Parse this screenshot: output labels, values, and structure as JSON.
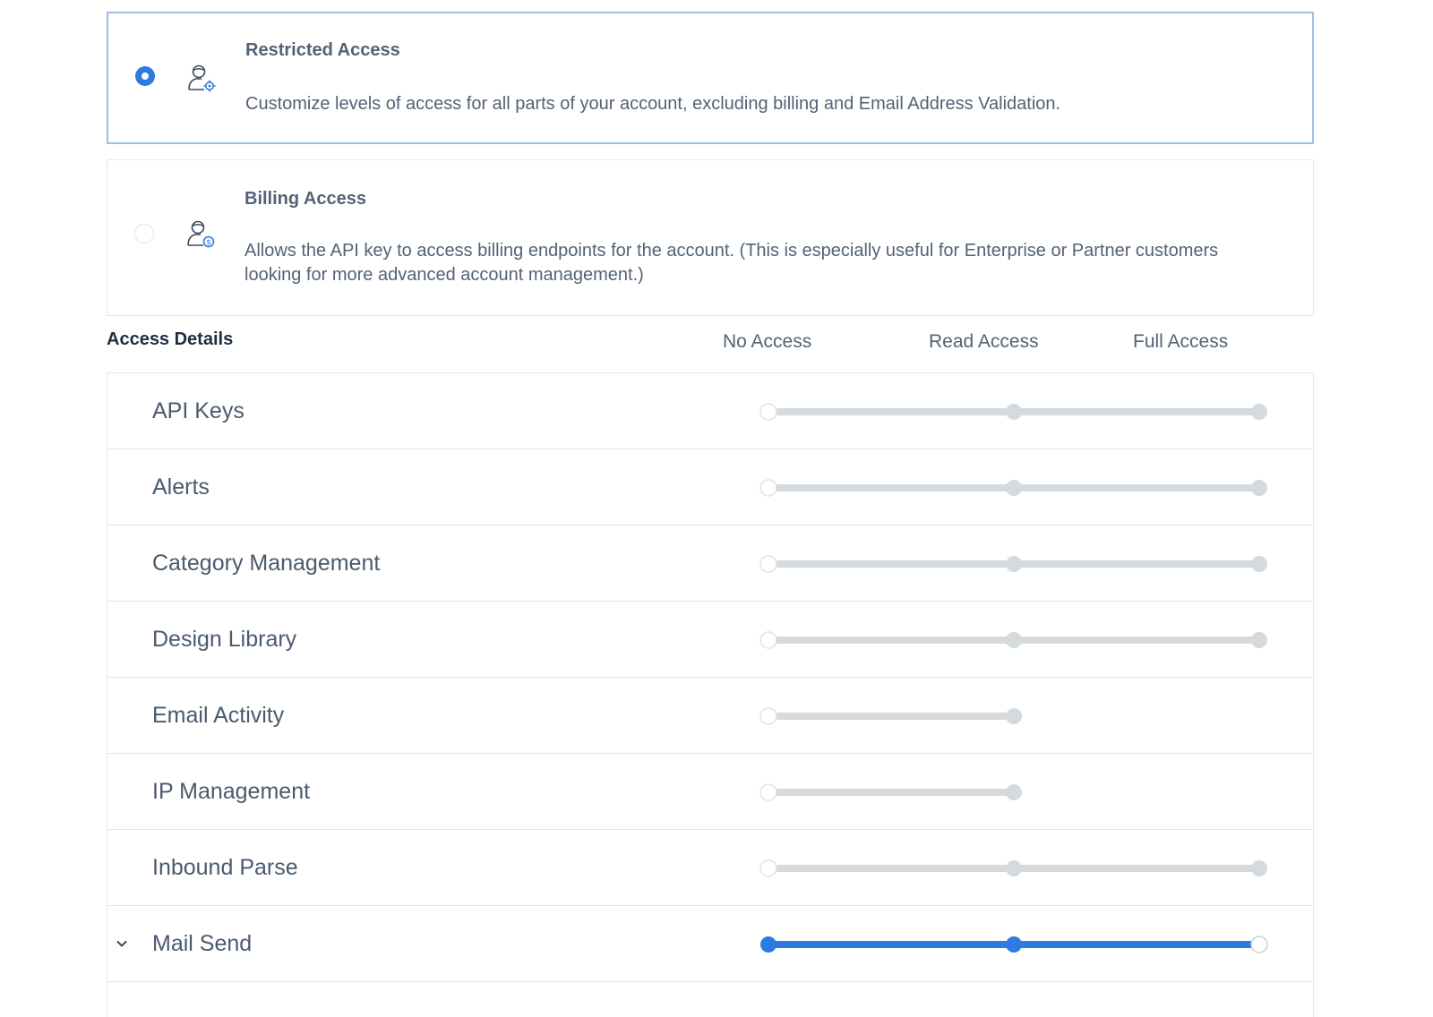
{
  "colors": {
    "accent": "#2d7be0",
    "track": "#d5dade",
    "text": "#546276",
    "border": "#e4e8ed"
  },
  "access_options": [
    {
      "title": "Restricted Access",
      "description": "Customize levels of access for all parts of your account, excluding billing and Email Address Validation.",
      "selected": true,
      "icon": "user-gear-icon"
    },
    {
      "title": "Billing Access",
      "description": "Allows the API key to access billing endpoints for the account. (This is especially useful for Enterprise or Partner customers looking for more advanced account management.)",
      "selected": false,
      "icon": "user-dollar-icon"
    }
  ],
  "access_details": {
    "title": "Access Details",
    "columns": [
      "No Access",
      "Read Access",
      "Full Access"
    ],
    "rows": [
      {
        "label": "API Keys",
        "levels": 3,
        "value": 0,
        "active": false,
        "expanded": false
      },
      {
        "label": "Alerts",
        "levels": 3,
        "value": 0,
        "active": false,
        "expanded": false
      },
      {
        "label": "Category Management",
        "levels": 3,
        "value": 0,
        "active": false,
        "expanded": false
      },
      {
        "label": "Design Library",
        "levels": 3,
        "value": 0,
        "active": false,
        "expanded": false
      },
      {
        "label": "Email Activity",
        "levels": 2,
        "value": 0,
        "active": false,
        "expanded": false
      },
      {
        "label": "IP Management",
        "levels": 2,
        "value": 0,
        "active": false,
        "expanded": false
      },
      {
        "label": "Inbound Parse",
        "levels": 3,
        "value": 0,
        "active": false,
        "expanded": false
      },
      {
        "label": "Mail Send",
        "levels": 3,
        "value": 2,
        "active": true,
        "expanded": true
      }
    ]
  }
}
